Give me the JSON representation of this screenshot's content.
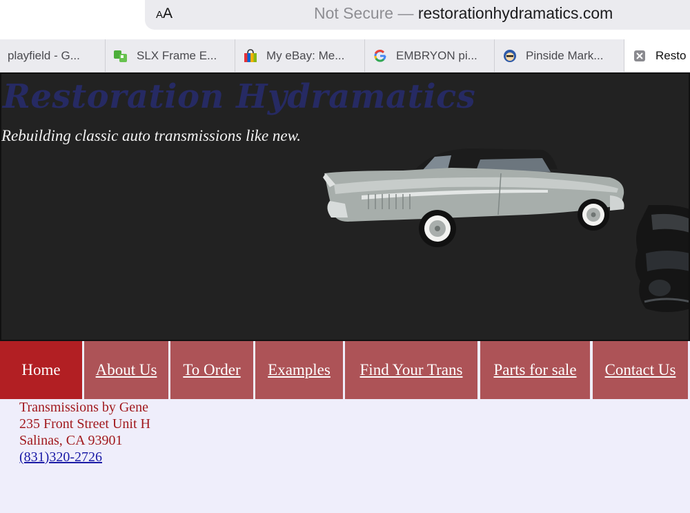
{
  "browser": {
    "aa_small": "A",
    "aa_big": "A",
    "security_label": "Not Secure —",
    "domain": "restorationhydramatics.com",
    "tabs": [
      {
        "label": "playfield - G...",
        "icon": "none"
      },
      {
        "label": "SLX Frame E...",
        "icon": "green-puzzle-icon"
      },
      {
        "label": "My eBay: Me...",
        "icon": "shopping-bag-icon"
      },
      {
        "label": "EMBRYON pi...",
        "icon": "google-icon"
      },
      {
        "label": "Pinside Mark...",
        "icon": "pinside-icon"
      },
      {
        "label": "Resto",
        "icon": "close-icon"
      }
    ]
  },
  "header": {
    "title": "Restoration Hydramatics",
    "tagline": "Rebuilding classic auto transmissions like new."
  },
  "nav": {
    "items": [
      {
        "label": "Home"
      },
      {
        "label": "About Us"
      },
      {
        "label": "To Order"
      },
      {
        "label": "Examples"
      },
      {
        "label": "Find Your Trans"
      },
      {
        "label": "Parts for sale"
      },
      {
        "label": "Contact Us"
      }
    ]
  },
  "address": {
    "name": "Transmissions by Gene",
    "street": "235 Front Street Unit H",
    "city": "Salinas, CA 93901",
    "phone": "(831)320-2726"
  },
  "colors": {
    "header_bg": "#222222",
    "title": "#262a63",
    "nav_active": "#b21f23",
    "nav_item": "#ad5357",
    "address_text": "#a1191d",
    "link": "#1a1aa6",
    "page_bg": "#efeefb"
  }
}
